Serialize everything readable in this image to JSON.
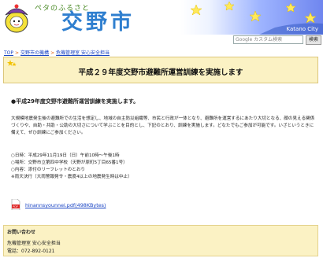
{
  "header": {
    "tagline": "ペタのふるさと",
    "city_name": "交野市",
    "banner_en": "Katano City",
    "search_placeholder": "Google カスタム検索",
    "search_button": "検索"
  },
  "breadcrumb": [
    "TOP",
    "交野市の機構",
    "危機管理室 安心安全担当"
  ],
  "page_title": "平成２９年度交野市避難所運営訓練を実施します",
  "subheading": "●平成29年度交野市避難所運営訓練を実施します。",
  "paragraph": "大規模地震発生後の避難所での生活を想定し、地域の自主防災組織等、市民と行政が一体となり、避難所を運営するにあたり大切となる、顔の見える関係づくりや、自助・共助・公助の大切さについて学ぶことを目的とし、下記のとおり、訓練を実施します。どなたでもご参加が可能です。いざというときに備えて、ぜひ訓練にご参加ください。",
  "details": [
    "○日時：平成29年11月19日（日）午前10時～午後1時",
    "○場所：交野市立第四中学校（天野が原町5丁目65番1号）",
    "○内容：添付のリーフレットのとおり",
    "※雨天決行（大雨警報発令・震度4以上の地震発生時は中止）"
  ],
  "attachment": "hinannsyounnei.pdf(498KBytes)",
  "contact": {
    "heading": "お問い合わせ",
    "department": "危機管理室 安心安全担当",
    "phone": "電話：072-892-0121"
  },
  "colors": {
    "title_blue": "#2f7fcf",
    "box_yellow": "#fbf2c4",
    "link_blue": "#1a45c4"
  }
}
